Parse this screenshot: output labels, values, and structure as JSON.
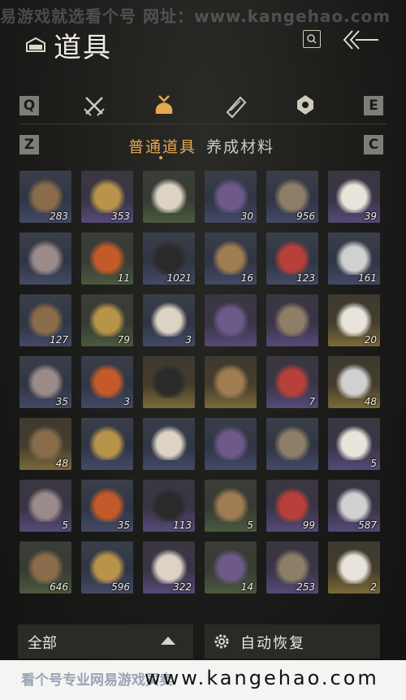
{
  "watermark": {
    "top": "易游戏就选看个号  网址：www.kangehao.com"
  },
  "header": {
    "title": "道具"
  },
  "category_keys": {
    "prev": "Q",
    "next": "E",
    "sub_prev": "Z",
    "sub_next": "C"
  },
  "categories": [
    "crossed-swords-icon",
    "money-bag-icon",
    "scroll-icon",
    "ornament-icon"
  ],
  "active_category": "money-bag-icon",
  "subtabs": {
    "active": "普通道具",
    "inactive": "养成材料"
  },
  "items": [
    {
      "count": "283",
      "tier": "blue"
    },
    {
      "count": "353",
      "tier": "purple"
    },
    {
      "count": "",
      "tier": "green"
    },
    {
      "count": "30",
      "tier": "blue"
    },
    {
      "count": "956",
      "tier": "blue"
    },
    {
      "count": "39",
      "tier": "purple"
    },
    {
      "count": "",
      "tier": "blue"
    },
    {
      "count": "11",
      "tier": "green"
    },
    {
      "count": "1021",
      "tier": "blue"
    },
    {
      "count": "16",
      "tier": "blue"
    },
    {
      "count": "123",
      "tier": "blue"
    },
    {
      "count": "161",
      "tier": "blue"
    },
    {
      "count": "127",
      "tier": "blue"
    },
    {
      "count": "79",
      "tier": "green"
    },
    {
      "count": "3",
      "tier": "blue"
    },
    {
      "count": "",
      "tier": "purple"
    },
    {
      "count": "",
      "tier": "purple"
    },
    {
      "count": "20",
      "tier": "gold"
    },
    {
      "count": "35",
      "tier": "blue"
    },
    {
      "count": "3",
      "tier": "blue"
    },
    {
      "count": "",
      "tier": "gold"
    },
    {
      "count": "",
      "tier": "gold"
    },
    {
      "count": "7",
      "tier": "purple"
    },
    {
      "count": "48",
      "tier": "gold"
    },
    {
      "count": "48",
      "tier": "gold"
    },
    {
      "count": "",
      "tier": "blue"
    },
    {
      "count": "",
      "tier": "blue"
    },
    {
      "count": "",
      "tier": "blue"
    },
    {
      "count": "",
      "tier": "blue"
    },
    {
      "count": "5",
      "tier": "purple"
    },
    {
      "count": "5",
      "tier": "purple"
    },
    {
      "count": "35",
      "tier": "blue"
    },
    {
      "count": "113",
      "tier": "purple"
    },
    {
      "count": "5",
      "tier": "green"
    },
    {
      "count": "99",
      "tier": "purple"
    },
    {
      "count": "587",
      "tier": "purple"
    },
    {
      "count": "646",
      "tier": "green"
    },
    {
      "count": "596",
      "tier": "blue"
    },
    {
      "count": "322",
      "tier": "purple"
    },
    {
      "count": "14",
      "tier": "green"
    },
    {
      "count": "253",
      "tier": "purple"
    },
    {
      "count": "2",
      "tier": "gold"
    }
  ],
  "bottom": {
    "filter_label": "全部",
    "auto_label": "自动恢复"
  },
  "footer": {
    "cn": "看个号专业网易游戏买卖",
    "url": "www.kangehao.com"
  }
}
